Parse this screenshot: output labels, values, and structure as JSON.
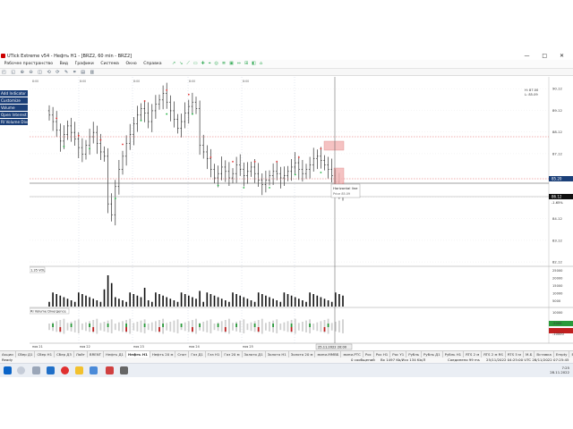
{
  "window": {
    "title": "UTick Extreme v54 - Нефть H1 - [BRZ2, 60 min - BRZ2]",
    "controls": [
      "—",
      "□",
      "✕"
    ]
  },
  "menu": {
    "items": [
      "Рабочее пространство",
      "Вид",
      "Графики",
      "Система",
      "Окно",
      "Справка"
    ]
  },
  "toolbar_icons": "↗ ↘ ⟋ ▭ ✚ ⌖ ◎ ≣ ▣ ⇔ ⊞ ◧ ⌂",
  "toolbar2_icons": "◰ ◱ ⊕ ⊖ ◫ ⟲ ⟳ ✎ ⌗ ▤ ▥",
  "sidebar": {
    "items": [
      "Add Indicator",
      "Customize",
      "Volume",
      "Open Interest",
      "RI Volume Diverg..."
    ]
  },
  "chart": {
    "info_lines": [
      "Н: 87.00",
      "L: 85.09"
    ],
    "price_ticks": [
      "90.12",
      "89.12",
      "88.12",
      "87.12",
      "85.12",
      "84.12",
      "83.12",
      "82.12"
    ],
    "current_price": "85.20",
    "neg_change": "-1.65%",
    "level_label": "86.12",
    "annotation_title": "Horizontal line",
    "annotation_sub": "Price 85.09",
    "volume_label": "1.35 VOL",
    "volume_ticks": [
      "25000",
      "20000",
      "15000",
      "10000",
      "5000"
    ],
    "div_label": "RI Volume Divergence",
    "div_ticks": [
      "10000",
      "-5000",
      "-10000"
    ],
    "time_labels": [
      "ноя 21",
      "ноя 22",
      "ноя 23",
      "ноя 24",
      "ноя 25"
    ],
    "hour_labels": [
      "8:00",
      "8:00",
      "8:00",
      "8:00",
      "8:00"
    ],
    "cursor_time": "25.11.2022  20:00"
  },
  "chart_data": {
    "type": "candlestick",
    "symbol": "BRZ2",
    "timeframe": "60 min",
    "closes": [
      88.9,
      88.6,
      88.2,
      87.7,
      88.0,
      88.4,
      88.1,
      87.8,
      87.4,
      87.1,
      87.5,
      87.9,
      88.1,
      87.6,
      87.2,
      87.0,
      84.8,
      84.3,
      85.6,
      86.4,
      87.0,
      87.6,
      88.0,
      88.5,
      88.9,
      89.2,
      89.0,
      88.6,
      89.1,
      89.4,
      89.6,
      89.9,
      89.5,
      89.1,
      88.7,
      88.3,
      88.6,
      89.0,
      89.3,
      89.5,
      89.2,
      87.5,
      87.2,
      86.9,
      86.4,
      86.0,
      86.2,
      86.5,
      86.3,
      86.0,
      86.2,
      86.6,
      86.4,
      86.1,
      86.3,
      86.5,
      86.2,
      85.9,
      85.7,
      85.9,
      86.1,
      86.3,
      86.2,
      86.0,
      86.1,
      86.3,
      86.5,
      86.7,
      86.4,
      86.2,
      86.4,
      86.6,
      86.9,
      87.0,
      86.8,
      86.6,
      86.4,
      86.1,
      85.8,
      85.4,
      85.2
    ],
    "ylim": [
      82,
      90.5
    ],
    "price_lines": [
      87.12,
      85.2,
      85.09
    ]
  },
  "tabs": [
    "Акции",
    "Сбер Д1",
    "Сбер H1",
    "Сбер Д3",
    "Лайт",
    "BRENT",
    "Нефть Д1",
    "Нефть H1",
    "Нефть 20 м",
    "Спот",
    "Газ Д1",
    "Газ H1",
    "Газ 20 м",
    "Золото Д1",
    "Золото H1",
    "Золото 20 м",
    "мини-ММВБ",
    "мини-РТС",
    "Рос",
    "Рос H1",
    "Рос Y1",
    "Рубль",
    "Рубль Д1",
    "Рубль H1",
    "RTS 2 м",
    "RTS 2 м RS",
    "RTS 5 м",
    "М-Б",
    "Вставка",
    "Empty",
    "Empty W5",
    "Empty W5"
  ],
  "active_tab": "Нефть H1",
  "status": {
    "left": "Ready",
    "mid1": "0 сообщений",
    "mid2": "Вх 1497 Kb/Исх 134 Kb/Л",
    "mid3": "Соединено 99 ms",
    "right": "25/11/2022 04:25:00 UTC  28/11/2022 07:25:45 Local"
  },
  "taskbar": {
    "time": "7:25",
    "date": "28.11.2022"
  }
}
